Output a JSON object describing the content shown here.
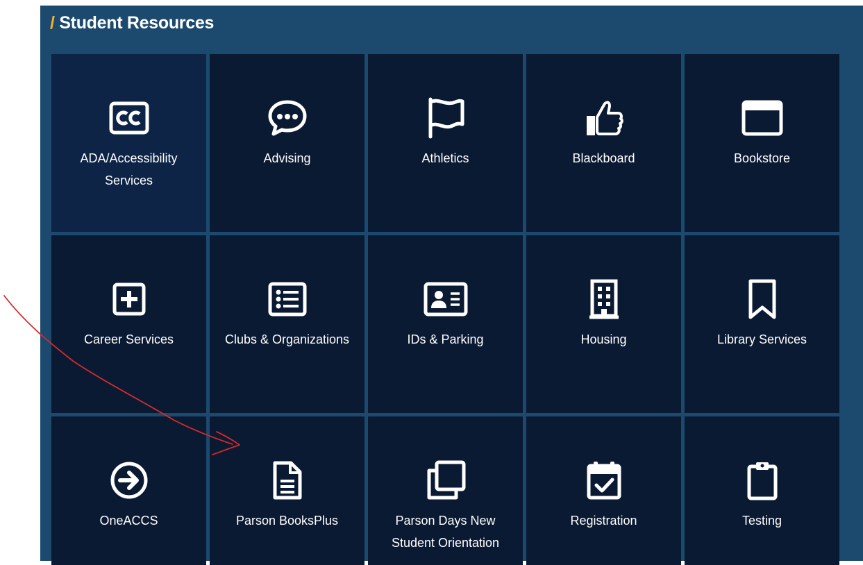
{
  "section": {
    "slash": "/",
    "title": "Student Resources"
  },
  "tiles": [
    {
      "label": "ADA/Accessibility Services",
      "icon": "closed-captioning-icon"
    },
    {
      "label": "Advising",
      "icon": "chat-bubble-icon"
    },
    {
      "label": "Athletics",
      "icon": "flag-icon"
    },
    {
      "label": "Blackboard",
      "icon": "thumbs-up-icon"
    },
    {
      "label": "Bookstore",
      "icon": "window-icon"
    },
    {
      "label": "Career Services",
      "icon": "plus-square-icon"
    },
    {
      "label": "Clubs & Organizations",
      "icon": "list-icon"
    },
    {
      "label": "IDs & Parking",
      "icon": "id-card-icon"
    },
    {
      "label": "Housing",
      "icon": "building-icon"
    },
    {
      "label": "Library Services",
      "icon": "bookmark-icon"
    },
    {
      "label": "OneACCS",
      "icon": "arrow-circle-right-icon"
    },
    {
      "label": "Parson BooksPlus",
      "icon": "document-icon"
    },
    {
      "label": "Parson Days New Student Orientation",
      "icon": "clone-icon"
    },
    {
      "label": "Registration",
      "icon": "calendar-check-icon"
    },
    {
      "label": "Testing",
      "icon": "clipboard-icon"
    }
  ],
  "colors": {
    "panel": "#1c4a6e",
    "tile": "#0b1a33",
    "tile_highlight": "#0d2446",
    "accent_slash": "#f2b233",
    "annotation": "#d42a2a"
  }
}
